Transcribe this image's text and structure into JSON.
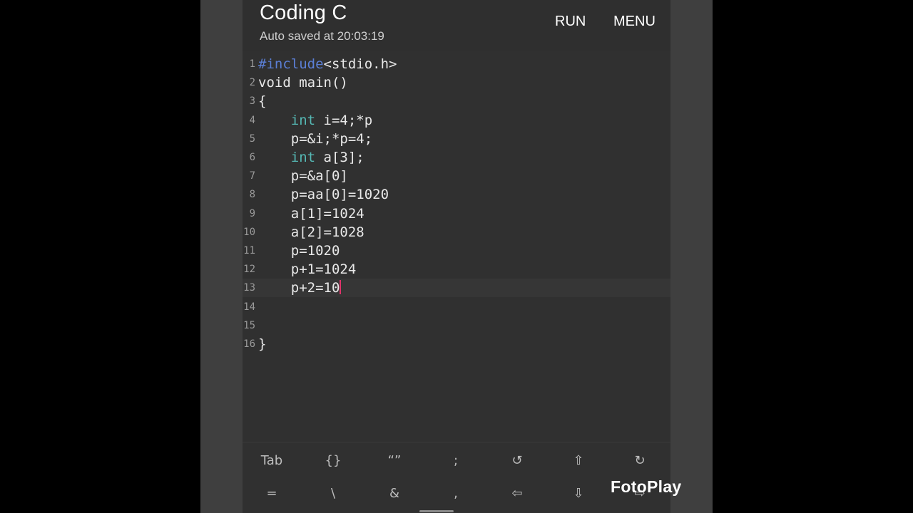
{
  "app": {
    "title": "Coding C",
    "subtitle": "Auto saved at 20:03:19",
    "run_label": "RUN",
    "menu_label": "MENU"
  },
  "editor": {
    "current_line": 13,
    "lines": [
      {
        "num": "1",
        "indent": "",
        "parts": [
          {
            "t": "#include",
            "c": "pre"
          },
          {
            "t": "<stdio.h>",
            "c": ""
          }
        ]
      },
      {
        "num": "2",
        "indent": "",
        "parts": [
          {
            "t": "void main()",
            "c": ""
          }
        ]
      },
      {
        "num": "3",
        "indent": "",
        "parts": [
          {
            "t": "{",
            "c": ""
          }
        ]
      },
      {
        "num": "4",
        "indent": "    ",
        "parts": [
          {
            "t": "int",
            "c": "type"
          },
          {
            "t": " i=4;*p",
            "c": ""
          }
        ]
      },
      {
        "num": "5",
        "indent": "    ",
        "parts": [
          {
            "t": "p=&i;*p=4;",
            "c": ""
          }
        ]
      },
      {
        "num": "6",
        "indent": "    ",
        "parts": [
          {
            "t": "int",
            "c": "type"
          },
          {
            "t": " a[3];",
            "c": ""
          }
        ]
      },
      {
        "num": "7",
        "indent": "    ",
        "parts": [
          {
            "t": "p=&a[0]",
            "c": ""
          }
        ]
      },
      {
        "num": "8",
        "indent": "    ",
        "parts": [
          {
            "t": "p=aa[0]=1020",
            "c": ""
          }
        ]
      },
      {
        "num": "9",
        "indent": "    ",
        "parts": [
          {
            "t": "a[1]=1024",
            "c": ""
          }
        ]
      },
      {
        "num": "10",
        "indent": "    ",
        "parts": [
          {
            "t": "a[2]=1028",
            "c": ""
          }
        ]
      },
      {
        "num": "11",
        "indent": "    ",
        "parts": [
          {
            "t": "p=1020",
            "c": ""
          }
        ]
      },
      {
        "num": "12",
        "indent": "    ",
        "parts": [
          {
            "t": "p+1=1024",
            "c": ""
          }
        ]
      },
      {
        "num": "13",
        "indent": "    ",
        "parts": [
          {
            "t": "p+2=10",
            "c": ""
          }
        ],
        "caret": true
      },
      {
        "num": "14",
        "indent": "",
        "parts": []
      },
      {
        "num": "15",
        "indent": "",
        "parts": []
      },
      {
        "num": "16",
        "indent": "",
        "parts": [
          {
            "t": "}",
            "c": ""
          }
        ]
      }
    ]
  },
  "keyboard": {
    "rows": [
      [
        {
          "label": "Tab",
          "name": "key-tab"
        },
        {
          "label": "{}",
          "name": "key-braces"
        },
        {
          "label": "“”",
          "name": "key-quotes"
        },
        {
          "label": ";",
          "name": "key-semicolon"
        },
        {
          "label": "↺",
          "name": "undo-icon"
        },
        {
          "label": "⇧",
          "name": "arrow-up-icon"
        },
        {
          "label": "↻",
          "name": "redo-icon"
        }
      ],
      [
        {
          "label": "=",
          "name": "key-equals"
        },
        {
          "label": "\\",
          "name": "key-backslash"
        },
        {
          "label": "&",
          "name": "key-ampersand"
        },
        {
          "label": ",",
          "name": "key-comma"
        },
        {
          "label": "⇦",
          "name": "arrow-left-icon"
        },
        {
          "label": "⇩",
          "name": "arrow-down-icon"
        },
        {
          "label": "⇨",
          "name": "arrow-right-icon"
        }
      ]
    ]
  },
  "watermark": "FotoPlay",
  "colors": {
    "preprocessor": "#5b7fd6",
    "type_keyword": "#55b8b4",
    "caret": "#e0336a",
    "background": "#303030"
  }
}
